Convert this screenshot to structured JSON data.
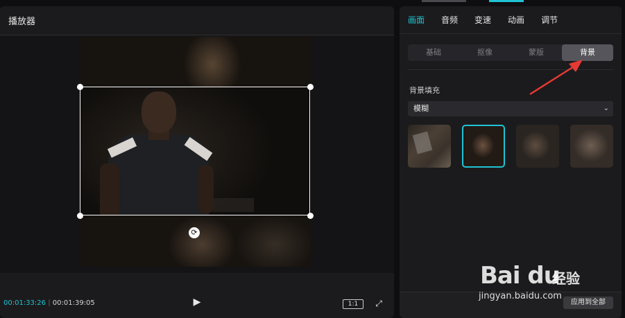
{
  "player": {
    "title": "播放器",
    "current_time": "00:01:33:26",
    "separator": "|",
    "total_time": "00:01:39:05",
    "ratio_label": "1:1",
    "play_icon": "play-icon",
    "fullscreen_icon": "fullscreen-icon"
  },
  "inspector": {
    "tabs": [
      {
        "label": "画面",
        "active": true
      },
      {
        "label": "音频",
        "active": false
      },
      {
        "label": "变速",
        "active": false
      },
      {
        "label": "动画",
        "active": false
      },
      {
        "label": "调节",
        "active": false
      }
    ],
    "subtabs": [
      {
        "label": "基础",
        "active": false
      },
      {
        "label": "抠像",
        "active": false
      },
      {
        "label": "蒙版",
        "active": false
      },
      {
        "label": "背景",
        "active": true
      }
    ],
    "background_fill": {
      "label": "背景填充",
      "selected": "模糊"
    },
    "apply_all": "应用到全部"
  },
  "watermark": {
    "brand": "Bai du",
    "suffix": "经验",
    "url": "jingyan.baidu.com"
  },
  "colors": {
    "accent": "#1fc3d3",
    "panel": "#1b1b1d",
    "arrow": "#e53935"
  }
}
